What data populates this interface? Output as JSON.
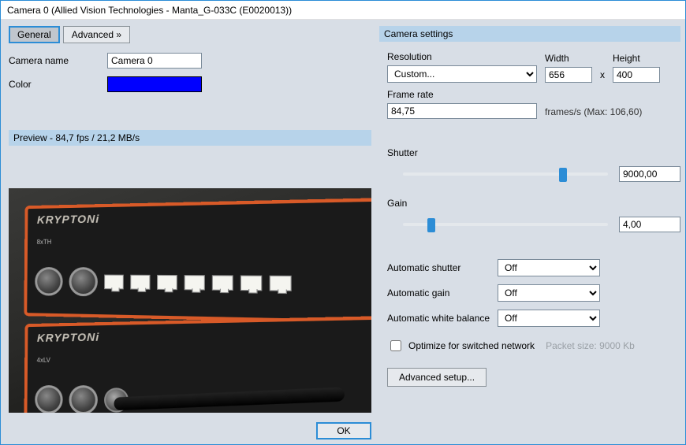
{
  "window": {
    "title": "Camera 0 (Allied Vision Technologies - Manta_G-033C (E0020013))"
  },
  "tabs": {
    "general": "General",
    "advanced": "Advanced »"
  },
  "general": {
    "camera_name_label": "Camera name",
    "camera_name_value": "Camera 0",
    "color_label": "Color",
    "color_value": "#0000ff"
  },
  "preview": {
    "header": "Preview  -  84,7 fps / 21,2 MB/s",
    "device_brand": "KRYPTONi",
    "sub_top": "8xTH",
    "sub_bottom": "4xLV"
  },
  "settings": {
    "title": "Camera settings",
    "resolution_label": "Resolution",
    "resolution_value": "Custom...",
    "width_label": "Width",
    "width_value": "656",
    "times": "x",
    "height_label": "Height",
    "height_value": "400",
    "frame_rate_label": "Frame rate",
    "frame_rate_value": "84,75",
    "frame_rate_hint": "frames/s (Max: 106,60)",
    "shutter_label": "Shutter",
    "shutter_value": "9000,00",
    "shutter_pos_pct": 76,
    "gain_label": "Gain",
    "gain_value": "4,00",
    "gain_pos_pct": 12,
    "auto_shutter_label": "Automatic shutter",
    "auto_shutter_value": "Off",
    "auto_gain_label": "Automatic gain",
    "auto_gain_value": "Off",
    "auto_wb_label": "Automatic white balance",
    "auto_wb_value": "Off",
    "optimize_label": "Optimize for switched network",
    "packet_label": "Packet size: 9000 Kb",
    "advanced_setup": "Advanced setup..."
  },
  "footer": {
    "ok": "OK"
  }
}
